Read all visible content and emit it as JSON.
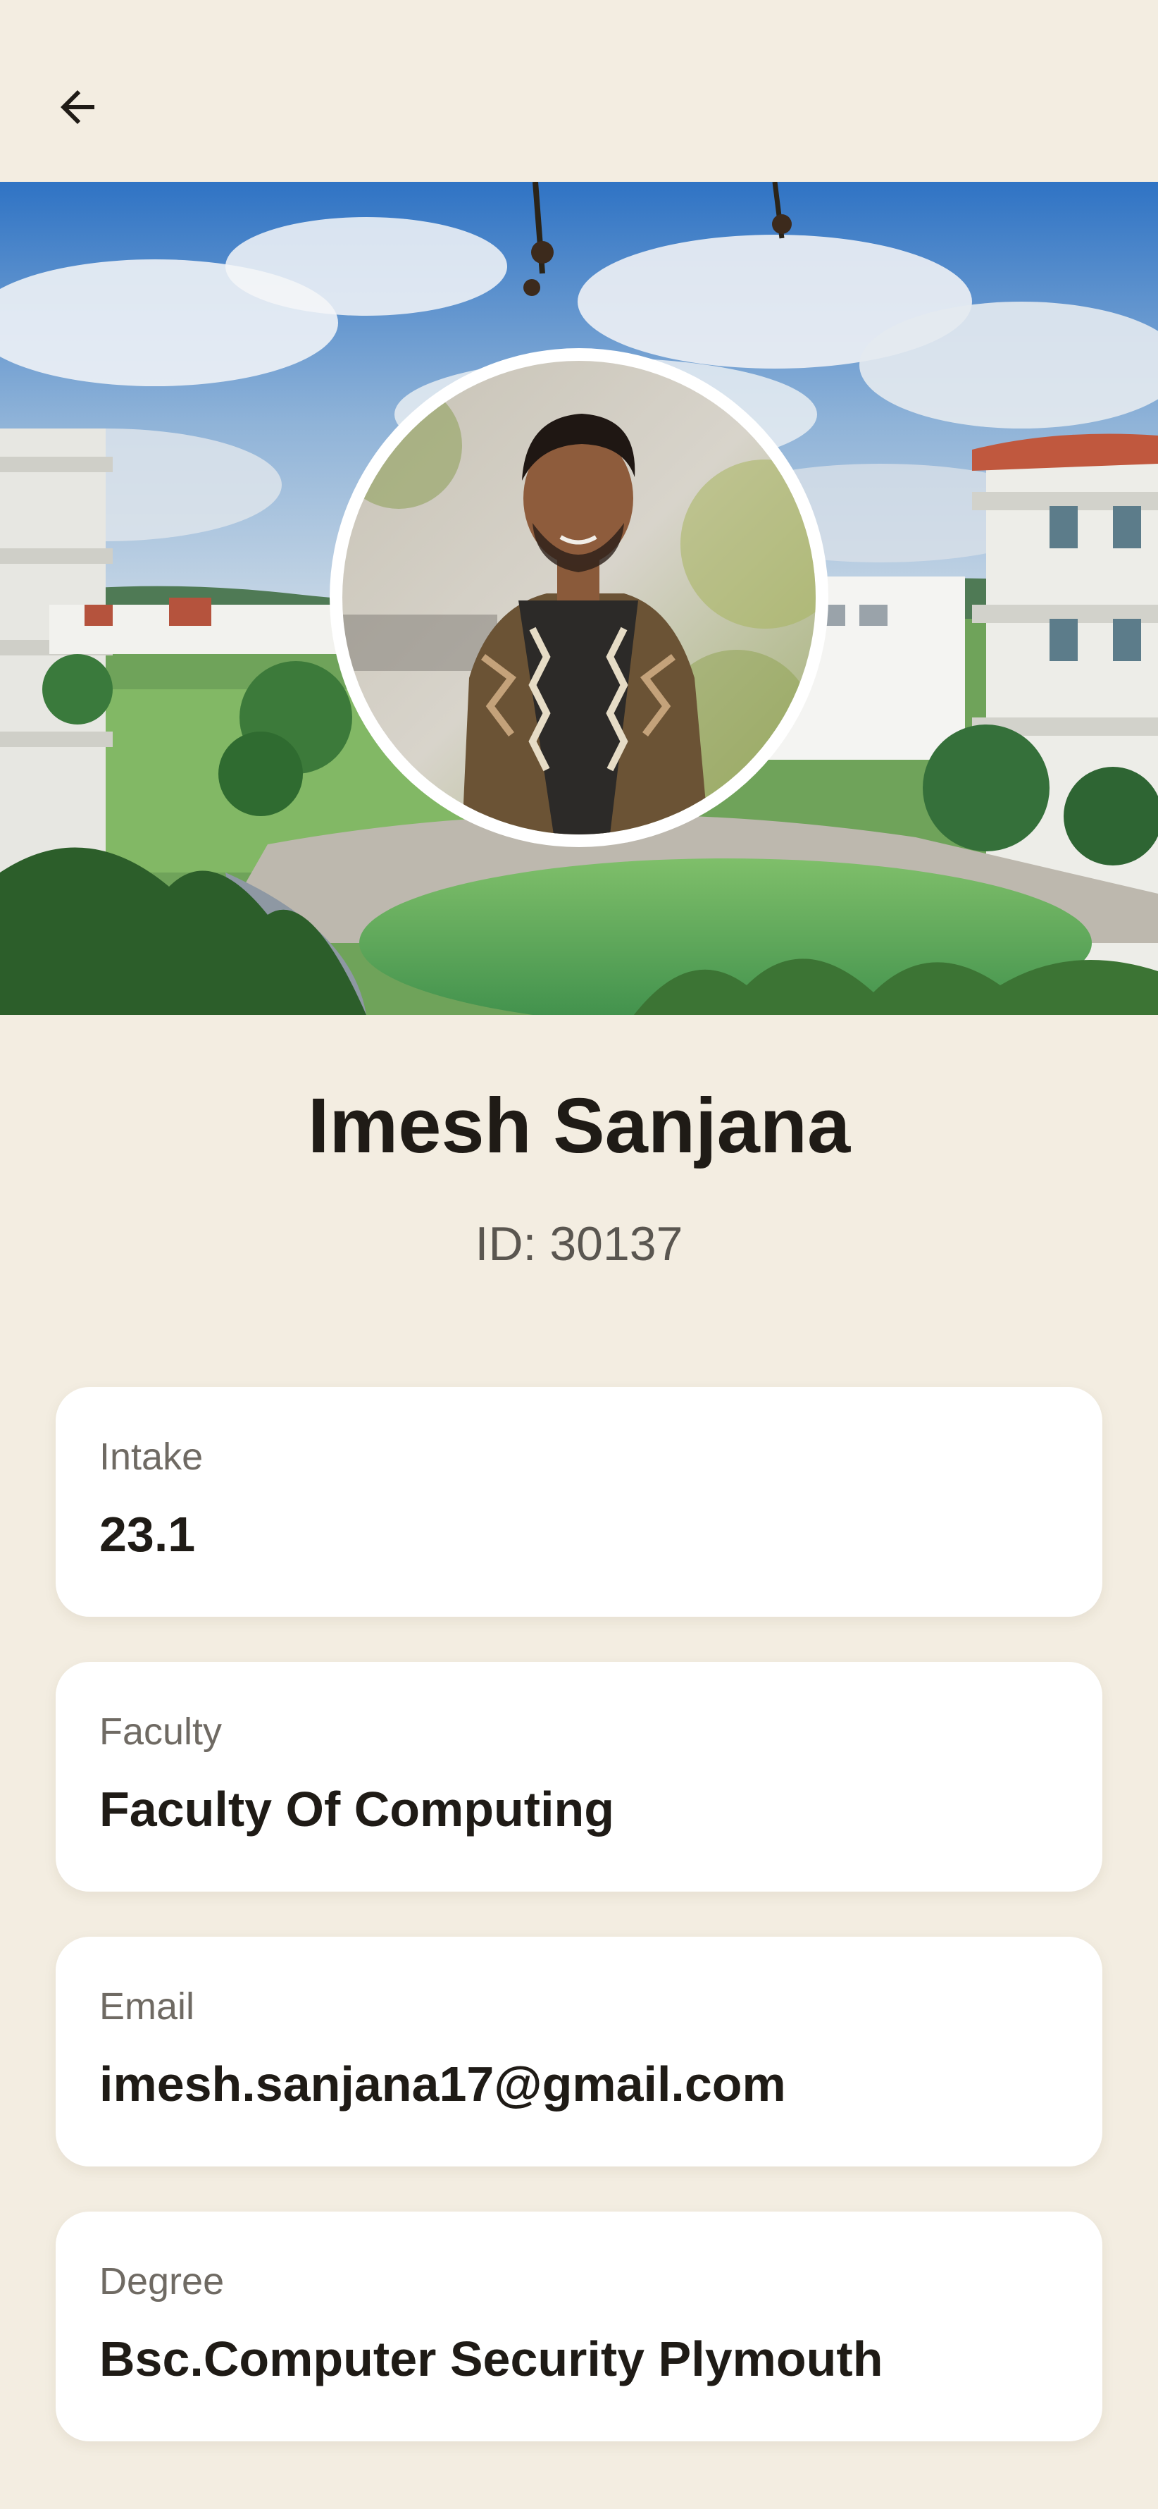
{
  "header": {
    "back_icon": "arrow-back-icon"
  },
  "profile": {
    "name": "Imesh Sanjana",
    "id_text": "ID: 30137"
  },
  "details": [
    {
      "label": "Intake",
      "value": "23.1"
    },
    {
      "label": "Faculty",
      "value": "Faculty Of Computing"
    },
    {
      "label": "Email",
      "value": "imesh.sanjana17@gmail.com"
    },
    {
      "label": "Degree",
      "value": "Bsc.Computer Security Plymouth"
    }
  ],
  "colors": {
    "background": "#F3EDE1",
    "card": "#FFFFFF",
    "text_primary": "#1F1B16",
    "text_secondary": "#6F6A63"
  }
}
